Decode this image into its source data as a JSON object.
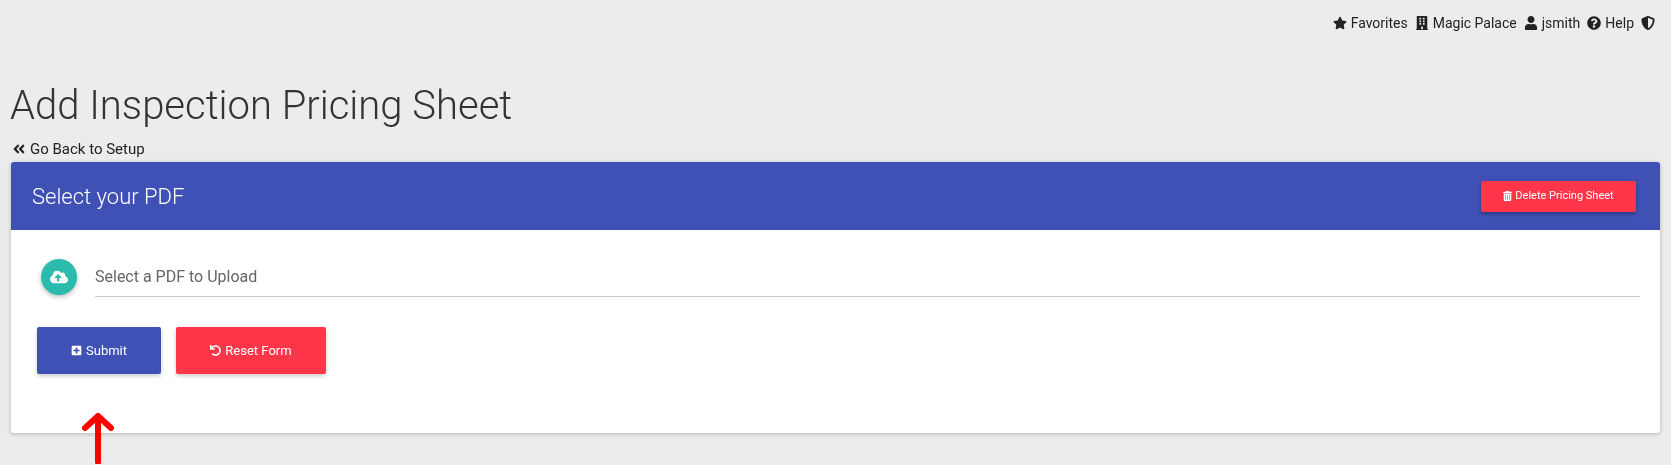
{
  "top_nav": [
    {
      "kind": "star",
      "label": "Favorites"
    },
    {
      "kind": "building",
      "label": "Magic Palace"
    },
    {
      "kind": "user",
      "label": "jsmith"
    },
    {
      "kind": "help",
      "label": "Help"
    },
    {
      "kind": "shield"
    }
  ],
  "page_title": "Add Inspection Pricing Sheet",
  "back_link": "Go Back to Setup",
  "card": {
    "title": "Select your PDF",
    "delete_button": "Delete Pricing Sheet",
    "upload_field": {
      "placeholder": "Select a PDF to Upload"
    },
    "buttons": [
      {
        "kind": "submit",
        "label": "Submit"
      },
      {
        "kind": "reset",
        "label": "Reset Form"
      }
    ]
  },
  "annotation": {
    "kind": "arrow"
  }
}
